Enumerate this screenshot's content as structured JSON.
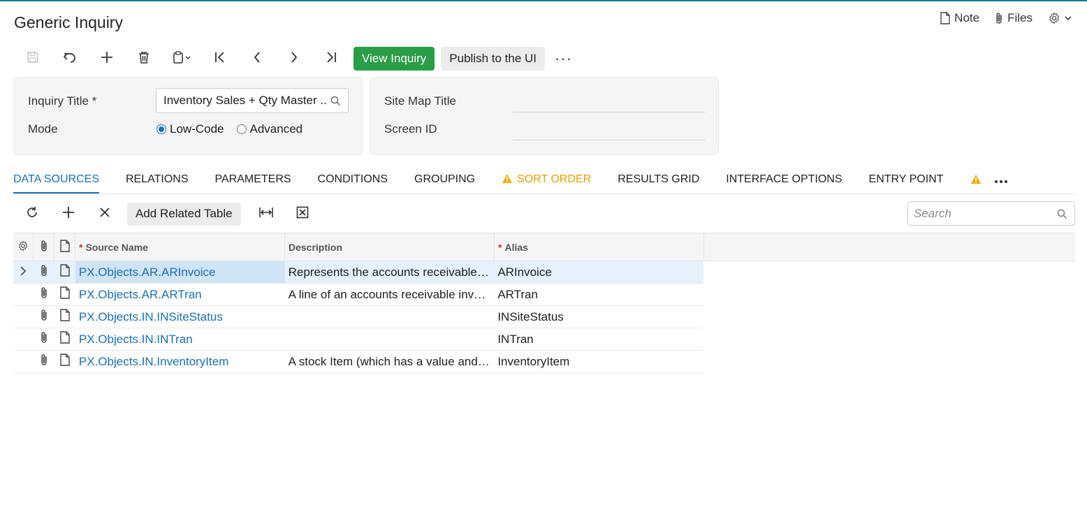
{
  "page": {
    "title": "Generic Inquiry",
    "accent_color": "#1a6fb6",
    "primary_color": "#2a9d47"
  },
  "header": {
    "note_label": "Note",
    "files_label": "Files",
    "settings_icon": "gear-icon"
  },
  "toolbar": {
    "icons": [
      "save-icon",
      "undo-icon",
      "plus-icon",
      "trash-icon",
      "clipboard-icon",
      "first-page-icon",
      "prev-icon",
      "next-icon",
      "last-page-icon"
    ],
    "view_inquiry_label": "View Inquiry",
    "publish_label": "Publish to the UI",
    "more_label": "···"
  },
  "form": {
    "inquiry_title_label": "Inquiry Title *",
    "inquiry_title_value": "Inventory Sales + Qty Master ..",
    "mode_label": "Mode",
    "mode_options": [
      "Low-Code",
      "Advanced"
    ],
    "mode_selected": "Low-Code",
    "site_map_title_label": "Site Map Title",
    "site_map_title_value": "",
    "screen_id_label": "Screen ID",
    "screen_id_value": ""
  },
  "tabs": [
    {
      "label": "DATA SOURCES",
      "active": true
    },
    {
      "label": "RELATIONS"
    },
    {
      "label": "PARAMETERS"
    },
    {
      "label": "CONDITIONS"
    },
    {
      "label": "GROUPING"
    },
    {
      "label": "SORT ORDER",
      "warning": true
    },
    {
      "label": "RESULTS GRID"
    },
    {
      "label": "INTERFACE OPTIONS"
    },
    {
      "label": "ENTRY POINT"
    }
  ],
  "grid_toolbar": {
    "add_related_table_label": "Add Related Table",
    "search_placeholder": "Search"
  },
  "grid": {
    "columns": {
      "source_name": "Source Name",
      "description": "Description",
      "alias": "Alias"
    },
    "rows": [
      {
        "source_name": "PX.Objects.AR.ARInvoice",
        "description": "Represents the accounts receivable …",
        "alias": "ARInvoice"
      },
      {
        "source_name": "PX.Objects.AR.ARTran",
        "description": "A line of an accounts receivable invo…",
        "alias": "ARTran"
      },
      {
        "source_name": "PX.Objects.IN.INSiteStatus",
        "description": "",
        "alias": "INSiteStatus"
      },
      {
        "source_name": "PX.Objects.IN.INTran",
        "description": "",
        "alias": "INTran"
      },
      {
        "source_name": "PX.Objects.IN.InventoryItem",
        "description": "A stock Item (which has a value and …",
        "alias": "InventoryItem"
      }
    ]
  }
}
